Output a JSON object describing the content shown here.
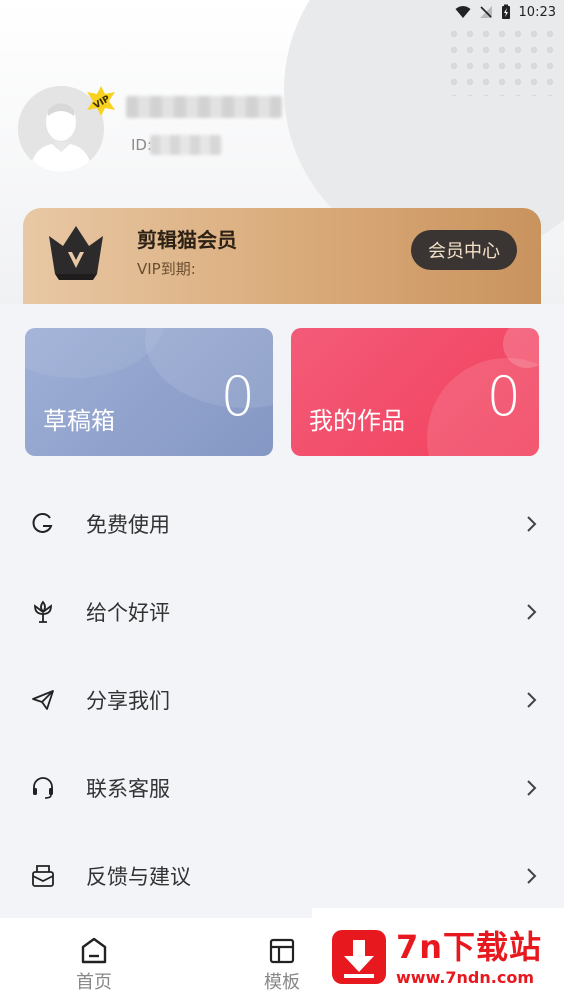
{
  "status_bar": {
    "time": "10:23"
  },
  "profile": {
    "id_label": "ID:"
  },
  "vip": {
    "title": "剪辑猫会员",
    "expire_label": "VIP到期:",
    "center_button": "会员中心",
    "badge_text": "VIP"
  },
  "stats": {
    "drafts": {
      "label": "草稿箱",
      "count": "0"
    },
    "works": {
      "label": "我的作品",
      "count": "0"
    }
  },
  "menu": {
    "items": [
      {
        "label": "免费使用",
        "icon": "g-icon"
      },
      {
        "label": "给个好评",
        "icon": "flower-icon"
      },
      {
        "label": "分享我们",
        "icon": "paper-plane-icon"
      },
      {
        "label": "联系客服",
        "icon": "headset-icon"
      },
      {
        "label": "反馈与建议",
        "icon": "mail-icon"
      }
    ]
  },
  "bottom_nav": {
    "items": [
      {
        "label": "首页",
        "icon": "home-icon"
      },
      {
        "label": "模板",
        "icon": "template-icon"
      }
    ]
  },
  "watermark": {
    "title": "7n下载站",
    "url": "www.7ndn.com"
  },
  "colors": {
    "vip_gold": "#d9aa79",
    "drafts_blue": "#8fa1cd",
    "works_red": "#f2405d",
    "watermark_red": "#e8191e"
  }
}
